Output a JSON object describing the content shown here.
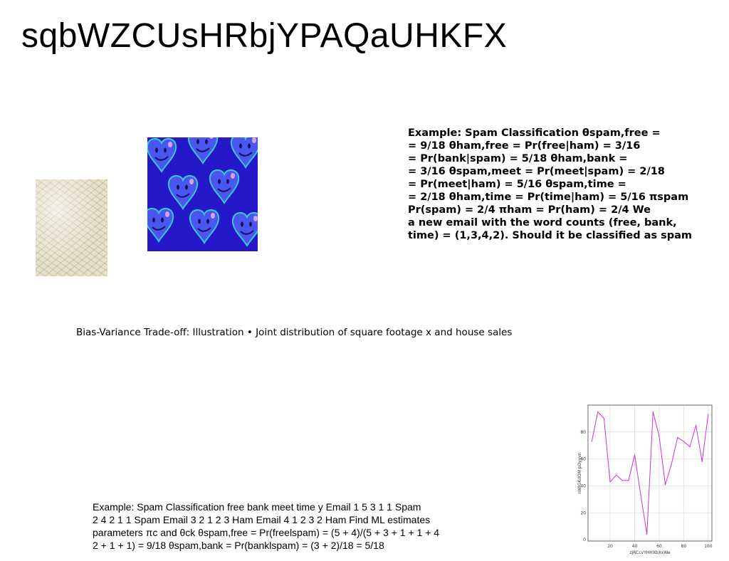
{
  "page": {
    "title": "sqbWZCUsHRbjYPAQaUHKFX",
    "caption": "Bias-Variance Trade-off: Illustration • Joint distribution of square footage x and house sales"
  },
  "example_block": {
    "lines": [
      "Example: Spam Classification θspam,free =",
      "= 9/18 θham,free = Pr(free|ham) = 3/16",
      "= Pr(bank|spam) = 5/18 θham,bank =",
      "= 3/16 θspam,meet = Pr(meet|spam) = 2/18",
      "= Pr(meet|ham) = 5/16 θspam,time =",
      "= 2/18 θham,time = Pr(time|ham) = 5/16 πspam",
      "Pr(spam) = 2/4 πham = Pr(ham) = 2/4 We",
      "a new email with the word counts (free, bank,",
      "time) = (1,3,4,2). Should it be classified as spam"
    ]
  },
  "body_block": {
    "lines": [
      "Example: Spam Classification free bank meet time y Email 1 5 3 1 1 Spam",
      "2 4 2 1 1 Spam Email 3 2 1 2 3 Ham Email 4 1 2 3 2 Ham Find ML estimates",
      "parameters πc and θck θspam,free = Pr(freelspam) = (5 + 4)/(5 + 3 + 1 + 1 + 4",
      "2 + 1 + 1) = 9/18 θspam,bank = Pr(banklspam) = (3 + 2)/18 = 5/18"
    ]
  },
  "images": {
    "net_texture": "net-texture-image",
    "hearts_pattern": "smiley-hearts-pattern-image"
  },
  "chart_data": {
    "type": "line",
    "xlabel": "zjRCcvYHHXbXxWe",
    "ylabel": "nWiGKdOM pDyyvn",
    "xlim": [
      0,
      100
    ],
    "ylim": [
      0,
      100
    ],
    "xticks": [
      20,
      40,
      60,
      80,
      100
    ],
    "yticks": [
      0,
      20,
      40,
      60,
      80
    ],
    "grid": true,
    "color": "#cc33cc",
    "x": [
      5,
      10,
      15,
      20,
      25,
      30,
      35,
      40,
      45,
      50,
      55,
      60,
      65,
      70,
      75,
      80,
      85,
      90,
      95,
      100
    ],
    "values": [
      73,
      95,
      90,
      43,
      48,
      44,
      44,
      63,
      33,
      4,
      95,
      77,
      41,
      56,
      76,
      73,
      69,
      85,
      58,
      93
    ]
  }
}
